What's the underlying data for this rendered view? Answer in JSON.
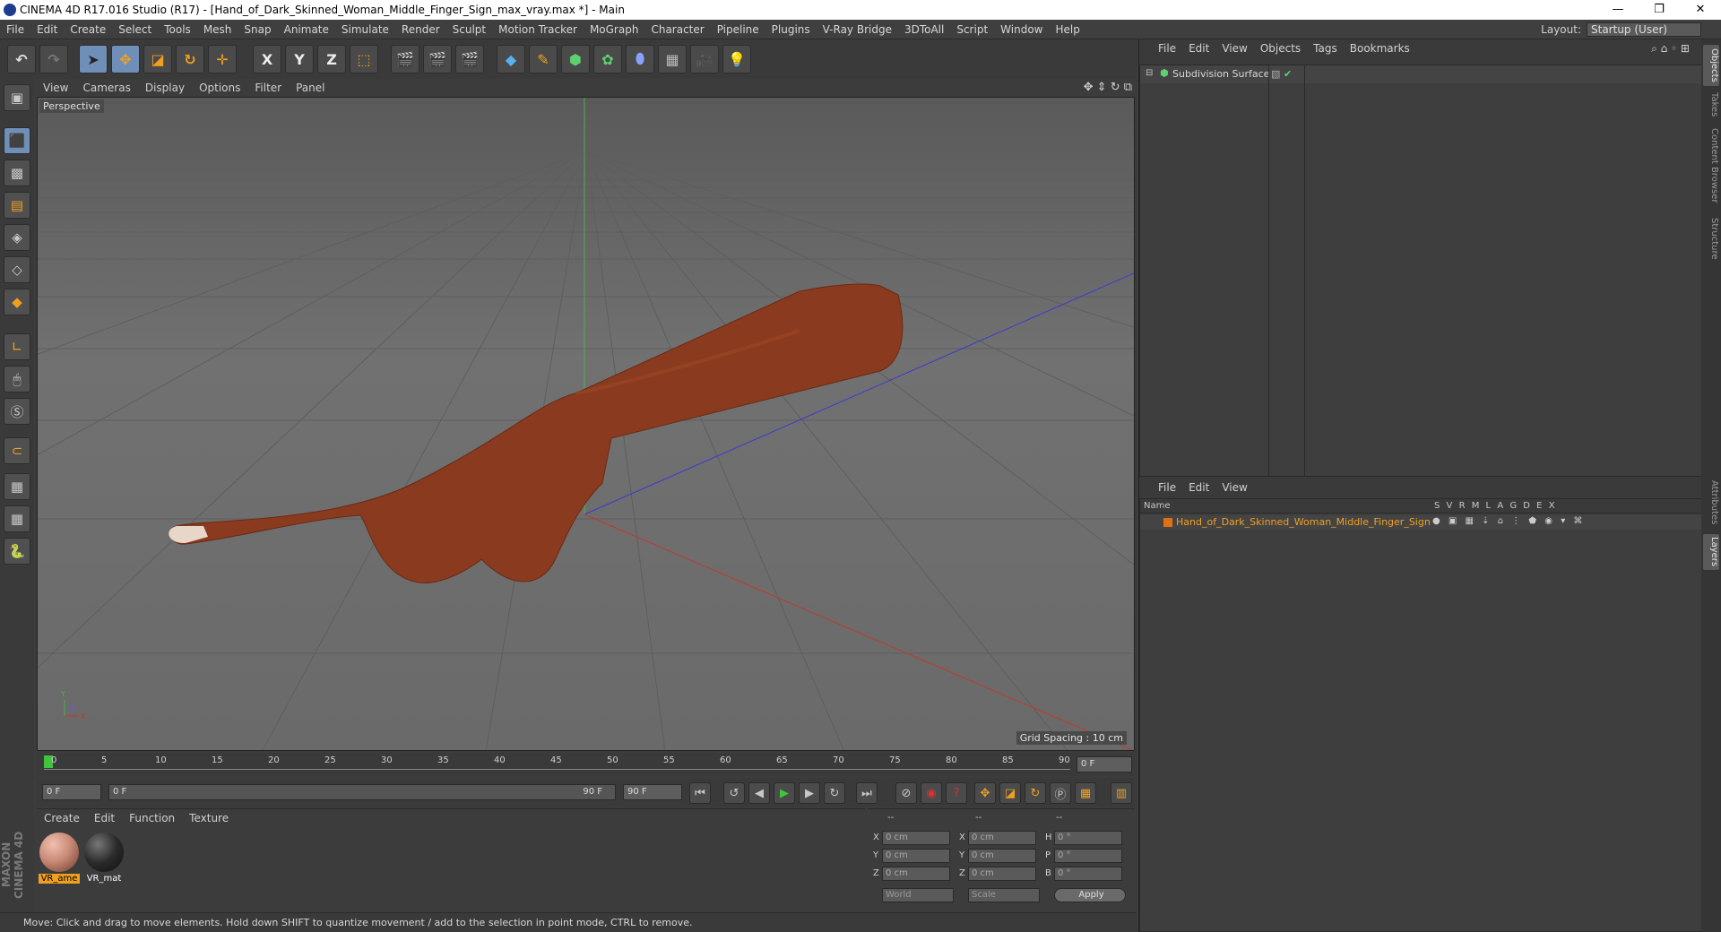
{
  "window": {
    "title": "CINEMA 4D R17.016 Studio (R17) - [Hand_of_Dark_Skinned_Woman_Middle_Finger_Sign_max_vray.max *] - Main",
    "controls": {
      "minimize": "—",
      "restore": "❐",
      "close": "✕"
    }
  },
  "menubar": {
    "items": [
      "File",
      "Edit",
      "Create",
      "Select",
      "Tools",
      "Mesh",
      "Snap",
      "Animate",
      "Simulate",
      "Render",
      "Sculpt",
      "Motion Tracker",
      "MoGraph",
      "Character",
      "Pipeline",
      "Plugins",
      "V-Ray Bridge",
      "3DToAll",
      "Script",
      "Window",
      "Help"
    ],
    "layout_label": "Layout:",
    "layout_value": "Startup (User)"
  },
  "toolbar": {
    "undo_icon": "↶",
    "redo_icon": "↷",
    "axis_x": "X",
    "axis_y": "Y",
    "axis_z": "Z"
  },
  "viewport": {
    "menu": [
      "View",
      "Cameras",
      "Display",
      "Options",
      "Filter",
      "Panel"
    ],
    "camera_label": "Perspective",
    "grid_spacing": "Grid Spacing : 10 cm",
    "axis_y_label": "Y",
    "axis_x_label": "X",
    "axis_z_label": "Z"
  },
  "timeline": {
    "ticks": [
      "0",
      "5",
      "10",
      "15",
      "20",
      "25",
      "30",
      "35",
      "40",
      "45",
      "50",
      "55",
      "60",
      "65",
      "70",
      "75",
      "80",
      "85",
      "90"
    ],
    "current_frame_right": "0 F",
    "start_field": "0 F",
    "range_start": "0 F",
    "range_end": "90 F",
    "end_field": "90 F"
  },
  "materials": {
    "menu": [
      "Create",
      "Edit",
      "Function",
      "Texture"
    ],
    "items": [
      {
        "label": "VR_ame",
        "selected": true,
        "color": "#c98b77"
      },
      {
        "label": "VR_mat",
        "selected": false,
        "color": "#2a2a2a"
      }
    ]
  },
  "coords": {
    "headers": [
      "--",
      "--",
      "--"
    ],
    "rows": [
      {
        "a": "X",
        "av": "0 cm",
        "b": "X",
        "bv": "0 cm",
        "c": "H",
        "cv": "0 °"
      },
      {
        "a": "Y",
        "av": "0 cm",
        "b": "Y",
        "bv": "0 cm",
        "c": "P",
        "cv": "0 °"
      },
      {
        "a": "Z",
        "av": "0 cm",
        "b": "Z",
        "bv": "0 cm",
        "c": "B",
        "cv": "0 °"
      }
    ],
    "world": "World",
    "scale": "Scale",
    "apply": "Apply"
  },
  "status": "Move: Click and drag to move elements. Hold down SHIFT to quantize movement / add to the selection in point mode, CTRL to remove.",
  "maxon": "MAXON CINEMA 4D",
  "object_manager": {
    "menu": [
      "File",
      "Edit",
      "View",
      "Objects",
      "Tags",
      "Bookmarks"
    ],
    "object_name": "Subdivision Surface"
  },
  "layer_manager": {
    "menu": [
      "File",
      "Edit",
      "View"
    ],
    "name_header": "Name",
    "columns": [
      "S",
      "V",
      "R",
      "M",
      "L",
      "A",
      "G",
      "D",
      "E",
      "X"
    ],
    "layer_name": "Hand_of_Dark_Skinned_Woman_Middle_Finger_Sign",
    "layer_color": "#e07010"
  },
  "side_tabs": [
    "Objects",
    "Takes",
    "Content Browser",
    "Structure",
    "Attributes",
    "Layers"
  ],
  "colors": {
    "accent": "#6f8fb8",
    "orange": "#f0a020",
    "skin": "#8a3a1e"
  }
}
